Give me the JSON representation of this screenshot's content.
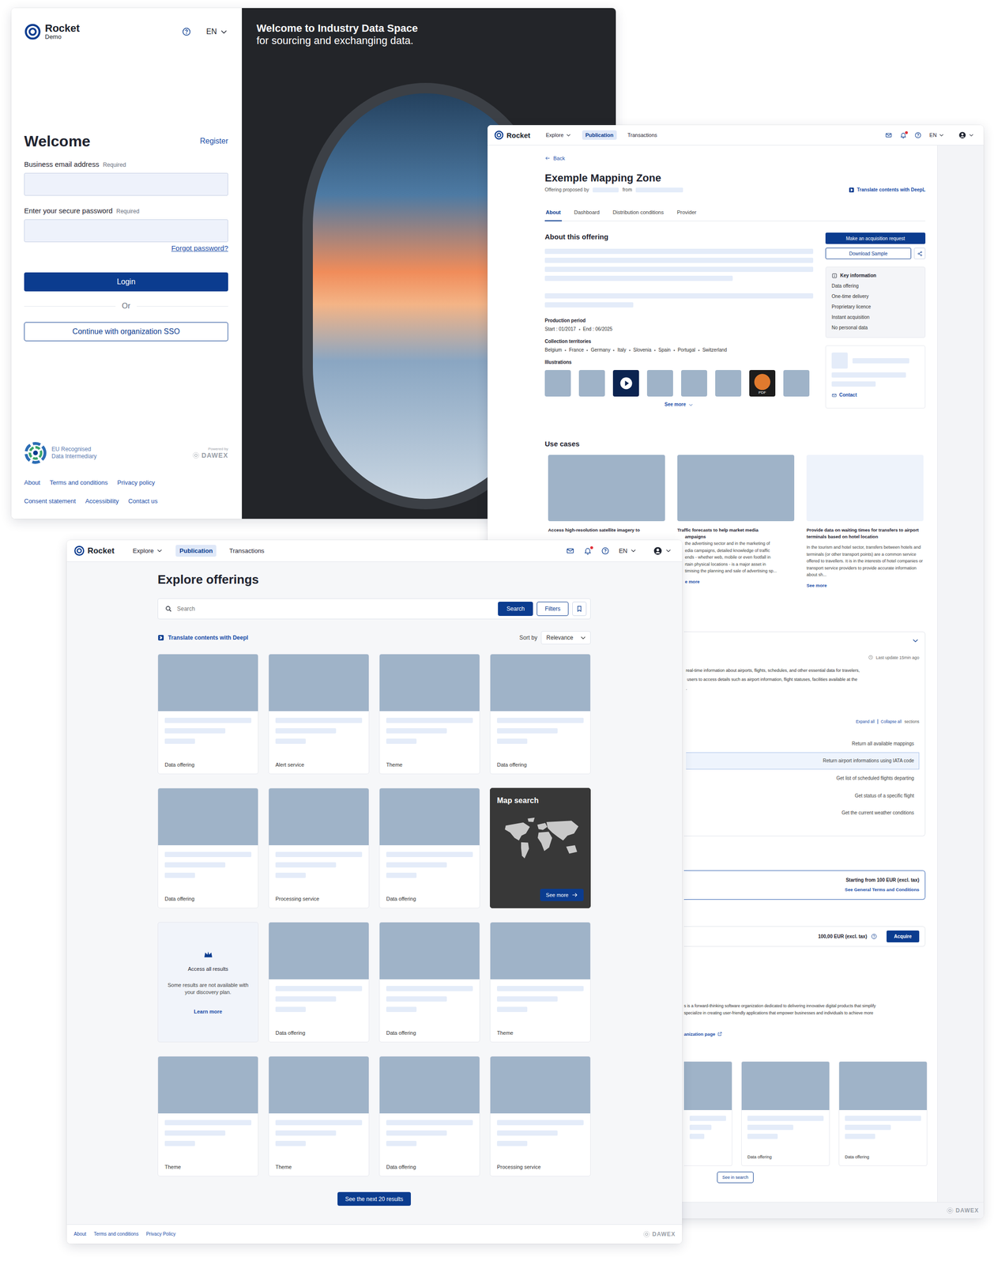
{
  "login": {
    "brand": {
      "name": "Rocket",
      "sub": "Demo"
    },
    "language": "EN",
    "title": "Welcome",
    "register": "Register",
    "fields": [
      {
        "label": "Business email address",
        "required": "Required",
        "value": ""
      },
      {
        "label": "Enter your secure password",
        "required": "Required",
        "value": ""
      }
    ],
    "forgot": "Forgot password?",
    "login_button": "Login",
    "separator": "Or",
    "sso_button": "Continue with organization SSO",
    "badge": [
      "EU Recognised",
      "Data Intermediary"
    ],
    "powered": {
      "caption": "Powered by",
      "name": "DAWEX"
    },
    "links": [
      [
        "About",
        "Terms and conditions",
        "Privacy policy"
      ],
      [
        "Consent statement",
        "Accessibility",
        "Contact us"
      ]
    ],
    "hero": {
      "title": "Welcome to Industry Data Space",
      "subtitle": "for sourcing and exchanging data."
    }
  },
  "offering_window": {
    "nav": {
      "brand": "Rocket",
      "items": [
        {
          "label": "Explore",
          "dropdown": true,
          "selected": false
        },
        {
          "label": "Publication",
          "dropdown": false,
          "selected": true
        },
        {
          "label": "Transactions",
          "dropdown": false,
          "selected": false
        }
      ],
      "language": "EN",
      "notification_dot": true
    },
    "back": "Back",
    "title": "Exemple Mapping Zone",
    "proposed": {
      "prefix": "Offering proposed by",
      "from": "from"
    },
    "translate": "Translate contents with DeepL",
    "tabs": [
      {
        "label": "About",
        "selected": true
      },
      {
        "label": "Dashboard",
        "selected": false
      },
      {
        "label": "Distribution conditions",
        "selected": false
      },
      {
        "label": "Provider",
        "selected": false
      }
    ],
    "about_heading": "About this offering",
    "production": {
      "label": "Production period",
      "start": "Start : 01/2017",
      "end": "End : 06/2025"
    },
    "territories": {
      "label": "Collection territories",
      "items": [
        "Belgium",
        "France",
        "Germany",
        "Italy",
        "Slovenia",
        "Spain",
        "Portugal",
        "Switzerland"
      ]
    },
    "illustrations": {
      "label": "Illustrations",
      "items": [
        {
          "kind": "image"
        },
        {
          "kind": "image"
        },
        {
          "kind": "video"
        },
        {
          "kind": "image"
        },
        {
          "kind": "image"
        },
        {
          "kind": "image"
        },
        {
          "kind": "pdf",
          "caption": "PDF"
        },
        {
          "kind": "image"
        }
      ],
      "more": "See more"
    },
    "actions": {
      "primary": "Make an acquisition request",
      "secondary": "Download Sample"
    },
    "key_info": {
      "title": "Key information",
      "items": [
        "Data offering",
        "One-time delivery",
        "Proprietary licence",
        "Instant acquisition",
        "No personal data"
      ]
    },
    "provider_card": {
      "contact": "Contact"
    },
    "use_cases": {
      "title": "Use cases",
      "cards": [
        {
          "kind": "hidden",
          "image": true,
          "title": "Access high-resolution satellite imagery to"
        },
        {
          "kind": "cut",
          "image": true,
          "title": "Traffic forecasts to help market media",
          "title_cont": "ampaigns",
          "lines": [
            "the advertising sector and in the marketing of",
            "edia campaigns, detailed knowledge of traffic",
            "ends - whether web, mobile or even footfall in",
            "rtain physical locations - is a major asset in",
            "timising the planning and sale of advertising sp..."
          ],
          "more": "e more"
        },
        {
          "kind": "full",
          "image": false,
          "title": "Provide data on waiting times for transfers to airport terminals based on hotel location",
          "text": "In the tourism and hotel sector, transfers between hotels and terminals (or other transport points) are a common service offered to travellers. It is in the interests of hotel companies or transport service providers to provide accurate information about sh...",
          "more": "See more"
        }
      ]
    },
    "api": {
      "updated": "Last update 15min ago",
      "lines": [
        "real-time information about airports, flights, schedules, and other essential data for travelers,",
        " users to access details such as airport information, flight statuses, facilities available at the",
        "."
      ],
      "expand": "Expand all",
      "collapse": "Collapse all",
      "sections": "sections",
      "mappings": [
        {
          "label": "Return all available mappings",
          "selected": false
        },
        {
          "label": "Return airport informations using IATA code",
          "selected": true
        },
        {
          "label": "Get list of scheduled flights departing",
          "selected": false
        },
        {
          "label": "Get status of a specific flight",
          "selected": false
        },
        {
          "label": "Get the current weather conditions",
          "selected": false
        }
      ]
    },
    "pricing": {
      "plan_title": "Starting from 100 EUR (excl. tax)",
      "plan_link": "See General Terms and Conditions",
      "plan_selected": true,
      "price": "100,00 EUR (excl. tax)",
      "acquire": "Acquire"
    },
    "provider": {
      "lines": [
        "s is a forward-thinking software organization dedicated to delivering innovative digital products that simplify",
        "specialize in creating user-friendly applications that empower businesses and individuals to achieve more"
      ],
      "link": "anization page"
    },
    "related": {
      "cards": [
        {
          "kind": "cut",
          "label": ""
        },
        {
          "kind": "full",
          "label": "Data offering"
        },
        {
          "kind": "full",
          "label": "Data offering"
        }
      ],
      "button": "See in search"
    },
    "footer_brand": "DAWEX"
  },
  "explore_window": {
    "nav": {
      "brand": "Rocket",
      "items": [
        {
          "label": "Explore",
          "dropdown": true,
          "selected": false
        },
        {
          "label": "Publication",
          "dropdown": false,
          "selected": true
        },
        {
          "label": "Transactions",
          "dropdown": false,
          "selected": false
        }
      ],
      "language": "EN",
      "notification_dot": true
    },
    "title": "Explore offerings",
    "search": {
      "placeholder": "Search",
      "button": "Search",
      "filters": "Filters"
    },
    "translate": "Translate contents with Deepl",
    "sort": {
      "label": "Sort by",
      "value": "Relevance"
    },
    "cards": [
      {
        "kind": "offering",
        "label": "Data offering"
      },
      {
        "kind": "offering",
        "label": "Alert service"
      },
      {
        "kind": "offering",
        "label": "Theme"
      },
      {
        "kind": "offering",
        "label": "Data offering"
      },
      {
        "kind": "offering",
        "label": "Data offering"
      },
      {
        "kind": "offering",
        "label": "Processing service"
      },
      {
        "kind": "offering",
        "label": "Data offering"
      },
      {
        "kind": "map",
        "title": "Map search",
        "button": "See more"
      },
      {
        "kind": "upsell",
        "title": "Access all results",
        "text": "Some results are not available with your discovery plan.",
        "link": "Learn more"
      },
      {
        "kind": "offering",
        "label": "Data offering"
      },
      {
        "kind": "offering",
        "label": "Data offering"
      },
      {
        "kind": "offering",
        "label": "Theme"
      },
      {
        "kind": "offering",
        "label": "Theme"
      },
      {
        "kind": "offering",
        "label": "Theme"
      },
      {
        "kind": "offering",
        "label": "Data offering"
      },
      {
        "kind": "offering",
        "label": "Processing service"
      }
    ],
    "next": "See the next 20 results",
    "footer": {
      "links": [
        "About",
        "Terms and conditions",
        "Privacy Policy"
      ],
      "brand": "DAWEX"
    }
  }
}
